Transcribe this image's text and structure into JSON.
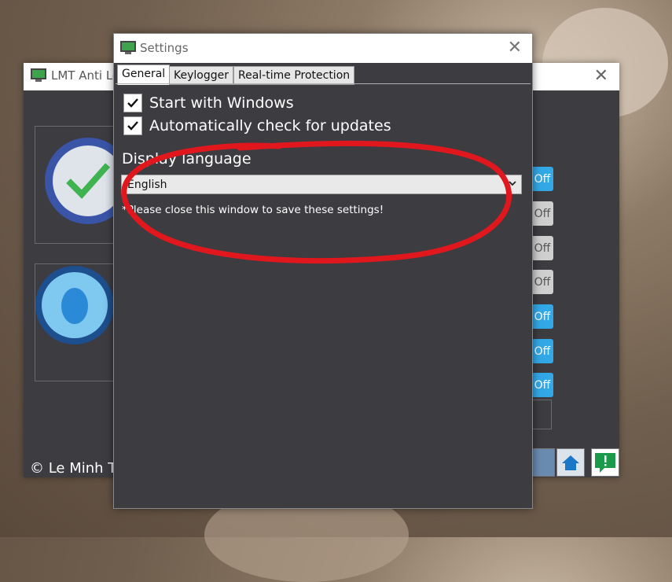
{
  "back_window": {
    "title": "LMT Anti Lo",
    "close_glyph": "✕",
    "toggles": [
      {
        "label": "Off",
        "state": "blue"
      },
      {
        "label": "Off",
        "state": "gray"
      },
      {
        "label": "Off",
        "state": "gray"
      },
      {
        "label": "Off",
        "state": "gray"
      },
      {
        "label": "Off",
        "state": "blue"
      },
      {
        "label": "Off",
        "state": "blue"
      },
      {
        "label": "Off",
        "state": "blue"
      }
    ],
    "copyright": "© Le Minh Th"
  },
  "settings": {
    "title": "Settings",
    "close_glyph": "✕",
    "tabs": [
      {
        "label": "General",
        "active": true
      },
      {
        "label": "Keylogger",
        "active": false
      },
      {
        "label": "Real-time Protection",
        "active": false
      }
    ],
    "general": {
      "start_with_windows": {
        "label": "Start with Windows",
        "checked": true
      },
      "auto_check_updates": {
        "label": "Automatically check for updates",
        "checked": true
      },
      "display_language_label": "Display language",
      "language_select": {
        "value": "English"
      },
      "note": "*Please close this window to save these settings!"
    }
  },
  "colors": {
    "window_bg": "#3d3c41",
    "accent_blue": "#33a8e6",
    "annotation_red": "#e0181e"
  },
  "icons": [
    "shield-logo-icon",
    "close-icon",
    "checkmark-icon",
    "chevron-down-icon",
    "clock-icon",
    "bug-icon",
    "home-icon",
    "feedback-icon",
    "log-icon"
  ]
}
